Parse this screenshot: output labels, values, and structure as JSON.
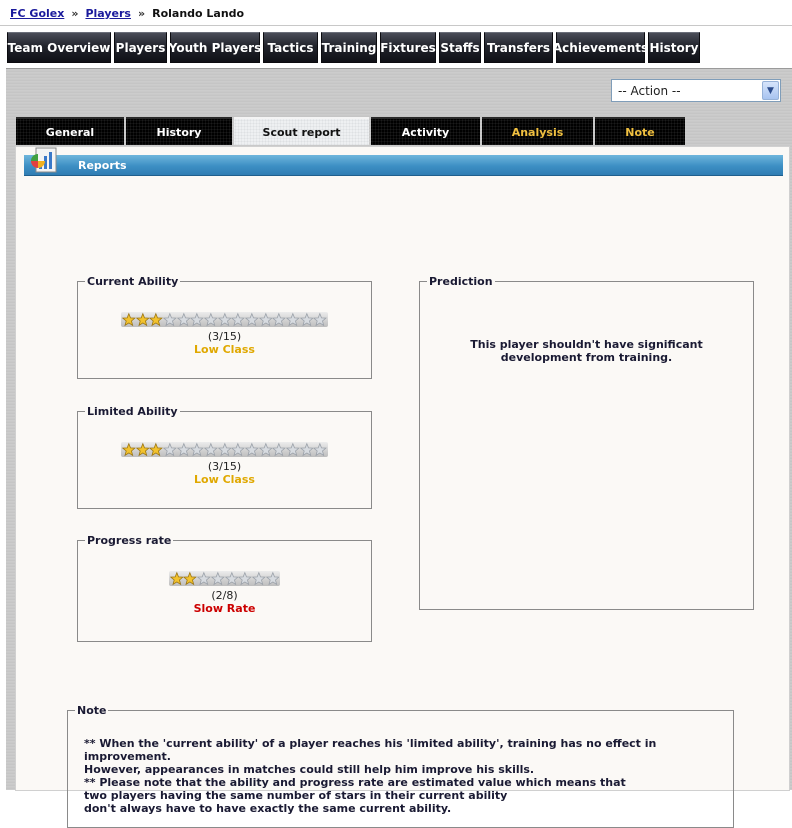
{
  "breadcrumb": {
    "club": "FC Golex",
    "section": "Players",
    "separator": "»",
    "player": "Rolando Lando"
  },
  "nav": [
    "Team Overview",
    "Players",
    "Youth Players",
    "Tactics",
    "Training",
    "Fixtures",
    "Staffs",
    "Transfers",
    "Achievements",
    "History"
  ],
  "action": {
    "selected": "-- Action --"
  },
  "tabs": [
    {
      "label": "General"
    },
    {
      "label": "History"
    },
    {
      "label": "Scout report",
      "active": true
    },
    {
      "label": "Activity"
    },
    {
      "label": "Analysis"
    },
    {
      "label": "Note"
    }
  ],
  "section": {
    "title": "Reports"
  },
  "current_ability": {
    "title": "Current Ability",
    "value": 3,
    "max": 15,
    "count_text": "(3/15)",
    "class_text": "Low Class"
  },
  "limited_ability": {
    "title": "Limited Ability",
    "value": 3,
    "max": 15,
    "count_text": "(3/15)",
    "class_text": "Low Class"
  },
  "progress_rate": {
    "title": "Progress rate",
    "value": 2,
    "max": 8,
    "count_text": "(2/8)",
    "class_text": "Slow Rate"
  },
  "prediction": {
    "title": "Prediction",
    "line1": "This player shouldn't have significant",
    "line2": "development from training."
  },
  "note": {
    "title": "Note",
    "p1_line1": "** When the 'current ability' of a player reaches his 'limited ability', training has no effect in improvement.",
    "p1_line2": "However, appearances in matches could still help him improve his skills.",
    "p2_line1": "** Please note that the ability and progress rate are estimated value which means that",
    "p2_line2": "two players having the same number of stars in their current ability",
    "p2_line3": "don't always have to have exactly the same current ability."
  },
  "colors": {
    "gold_text": "#e0a800",
    "red_text": "#cc0000",
    "tab_gold": "#f0c040",
    "header_blue": "#3d8fc4"
  }
}
